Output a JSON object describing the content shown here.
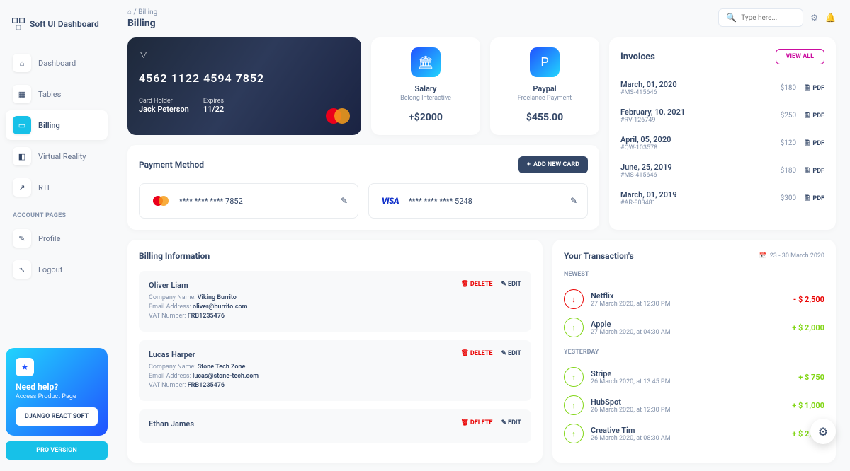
{
  "brand": "Soft UI Dashboard",
  "nav": {
    "items": [
      {
        "label": "Dashboard",
        "icon": "⌂"
      },
      {
        "label": "Tables",
        "icon": "▦"
      },
      {
        "label": "Billing",
        "icon": "▭"
      },
      {
        "label": "Virtual Reality",
        "icon": "◧"
      },
      {
        "label": "RTL",
        "icon": "↗"
      }
    ],
    "section_label": "ACCOUNT PAGES",
    "account": [
      {
        "label": "Profile",
        "icon": "✎"
      },
      {
        "label": "Logout",
        "icon": "➴"
      }
    ]
  },
  "help": {
    "title": "Need help?",
    "sub": "Access Product Page",
    "btn": "DJANGO REACT SOFT",
    "pro": "PRO VERSION"
  },
  "breadcrumb": {
    "home": "⌂",
    "sep": "/",
    "current": "Billing"
  },
  "page_title": "Billing",
  "search": {
    "placeholder": "Type here..."
  },
  "cc": {
    "number": "4562  1122  4594  7852",
    "holder_label": "Card Holder",
    "holder": "Jack Peterson",
    "expires_label": "Expires",
    "expires": "11/22"
  },
  "stats": [
    {
      "title": "Salary",
      "sub": "Belong Interactive",
      "amount": "+$2000",
      "icon": "bank"
    },
    {
      "title": "Paypal",
      "sub": "Freelance Payment",
      "amount": "$455.00",
      "icon": "paypal"
    }
  ],
  "invoices": {
    "title": "Invoices",
    "view_all": "VIEW ALL",
    "pdf_label": "PDF",
    "items": [
      {
        "date": "March, 01, 2020",
        "id": "#MS-415646",
        "amount": "$180"
      },
      {
        "date": "February, 10, 2021",
        "id": "#RV-126749",
        "amount": "$250"
      },
      {
        "date": "April, 05, 2020",
        "id": "#QW-103578",
        "amount": "$120"
      },
      {
        "date": "June, 25, 2019",
        "id": "#MS-415646",
        "amount": "$180"
      },
      {
        "date": "March, 01, 2019",
        "id": "#AR-803481",
        "amount": "$300"
      }
    ]
  },
  "payment": {
    "title": "Payment Method",
    "add": "ADD NEW CARD",
    "cards": [
      {
        "brand": "mastercard",
        "masked": "****  ****  ****  7852"
      },
      {
        "brand": "visa",
        "masked": "****  ****  ****  5248"
      }
    ]
  },
  "billing": {
    "title": "Billing Information",
    "labels": {
      "company": "Company Name:",
      "email": "Email Address:",
      "vat": "VAT Number:",
      "delete": "DELETE",
      "edit": "EDIT"
    },
    "items": [
      {
        "name": "Oliver Liam",
        "company": "Viking Burrito",
        "email": "oliver@burrito.com",
        "vat": "FRB1235476"
      },
      {
        "name": "Lucas Harper",
        "company": "Stone Tech Zone",
        "email": "lucas@stone-tech.com",
        "vat": "FRB1235476"
      },
      {
        "name": "Ethan James",
        "company": "",
        "email": "",
        "vat": ""
      }
    ]
  },
  "transactions": {
    "title": "Your Transaction's",
    "range": "23 - 30 March 2020",
    "newest": "NEWEST",
    "yesterday": "YESTERDAY",
    "newest_items": [
      {
        "name": "Netflix",
        "time": "27 March 2020, at 12:30 PM",
        "amount": "- $ 2,500",
        "dir": "down"
      },
      {
        "name": "Apple",
        "time": "27 March 2020, at 04:30 AM",
        "amount": "+ $ 2,000",
        "dir": "up"
      }
    ],
    "yesterday_items": [
      {
        "name": "Stripe",
        "time": "26 March 2020, at 13:45 PM",
        "amount": "+ $ 750",
        "dir": "up"
      },
      {
        "name": "HubSpot",
        "time": "26 March 2020, at 12:30 PM",
        "amount": "+ $ 1,000",
        "dir": "up"
      },
      {
        "name": "Creative Tim",
        "time": "26 March 2020, at 08:30 AM",
        "amount": "+ $ 2,500",
        "dir": "up"
      }
    ]
  }
}
